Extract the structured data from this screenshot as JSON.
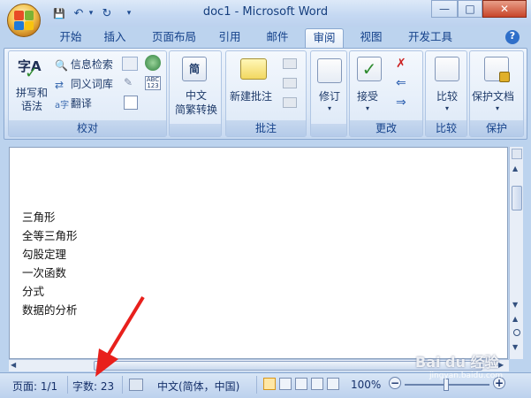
{
  "window": {
    "title": "doc1 - Microsoft Word",
    "minimize": "—",
    "maximize": "□",
    "close": "✕"
  },
  "qat": {
    "save": "💾",
    "undo": "↶",
    "redo": "↻",
    "more": "▾"
  },
  "tabs": [
    "开始",
    "插入",
    "页面布局",
    "引用",
    "邮件",
    "审阅",
    "视图",
    "开发工具"
  ],
  "active_tab": "审阅",
  "help": "?",
  "ribbon": {
    "proofing": {
      "label": "校对",
      "spell": "拼写和\n语法",
      "spell_line1": "拼写和",
      "spell_line2": "语法",
      "research": "信息检索",
      "thesaurus": "同义词库",
      "translate": "翻译"
    },
    "chinese": {
      "line1": "中文",
      "line2": "简繁转换"
    },
    "comments": {
      "label": "批注",
      "new": "新建批注"
    },
    "tracking": {
      "revise": "修订"
    },
    "changes": {
      "label": "更改",
      "accept": "接受"
    },
    "compare": {
      "label": "比较"
    },
    "protect": {
      "label": "保护",
      "button": "保护文档"
    }
  },
  "document": {
    "lines": [
      "三角形",
      "全等三角形",
      "勾股定理",
      "一次函数",
      "分式",
      "数据的分析"
    ]
  },
  "status": {
    "page": "页面: 1/1",
    "words": "字数: 23",
    "language": "中文(简体，中国)",
    "zoom": "100%",
    "zoom_minus": "−",
    "zoom_plus": "+"
  },
  "watermark": {
    "brand": "Bai du 经验",
    "url": "jingyan.baidu.com"
  },
  "colors": {
    "accent": "#15428b",
    "arrow": "#e8201c"
  }
}
